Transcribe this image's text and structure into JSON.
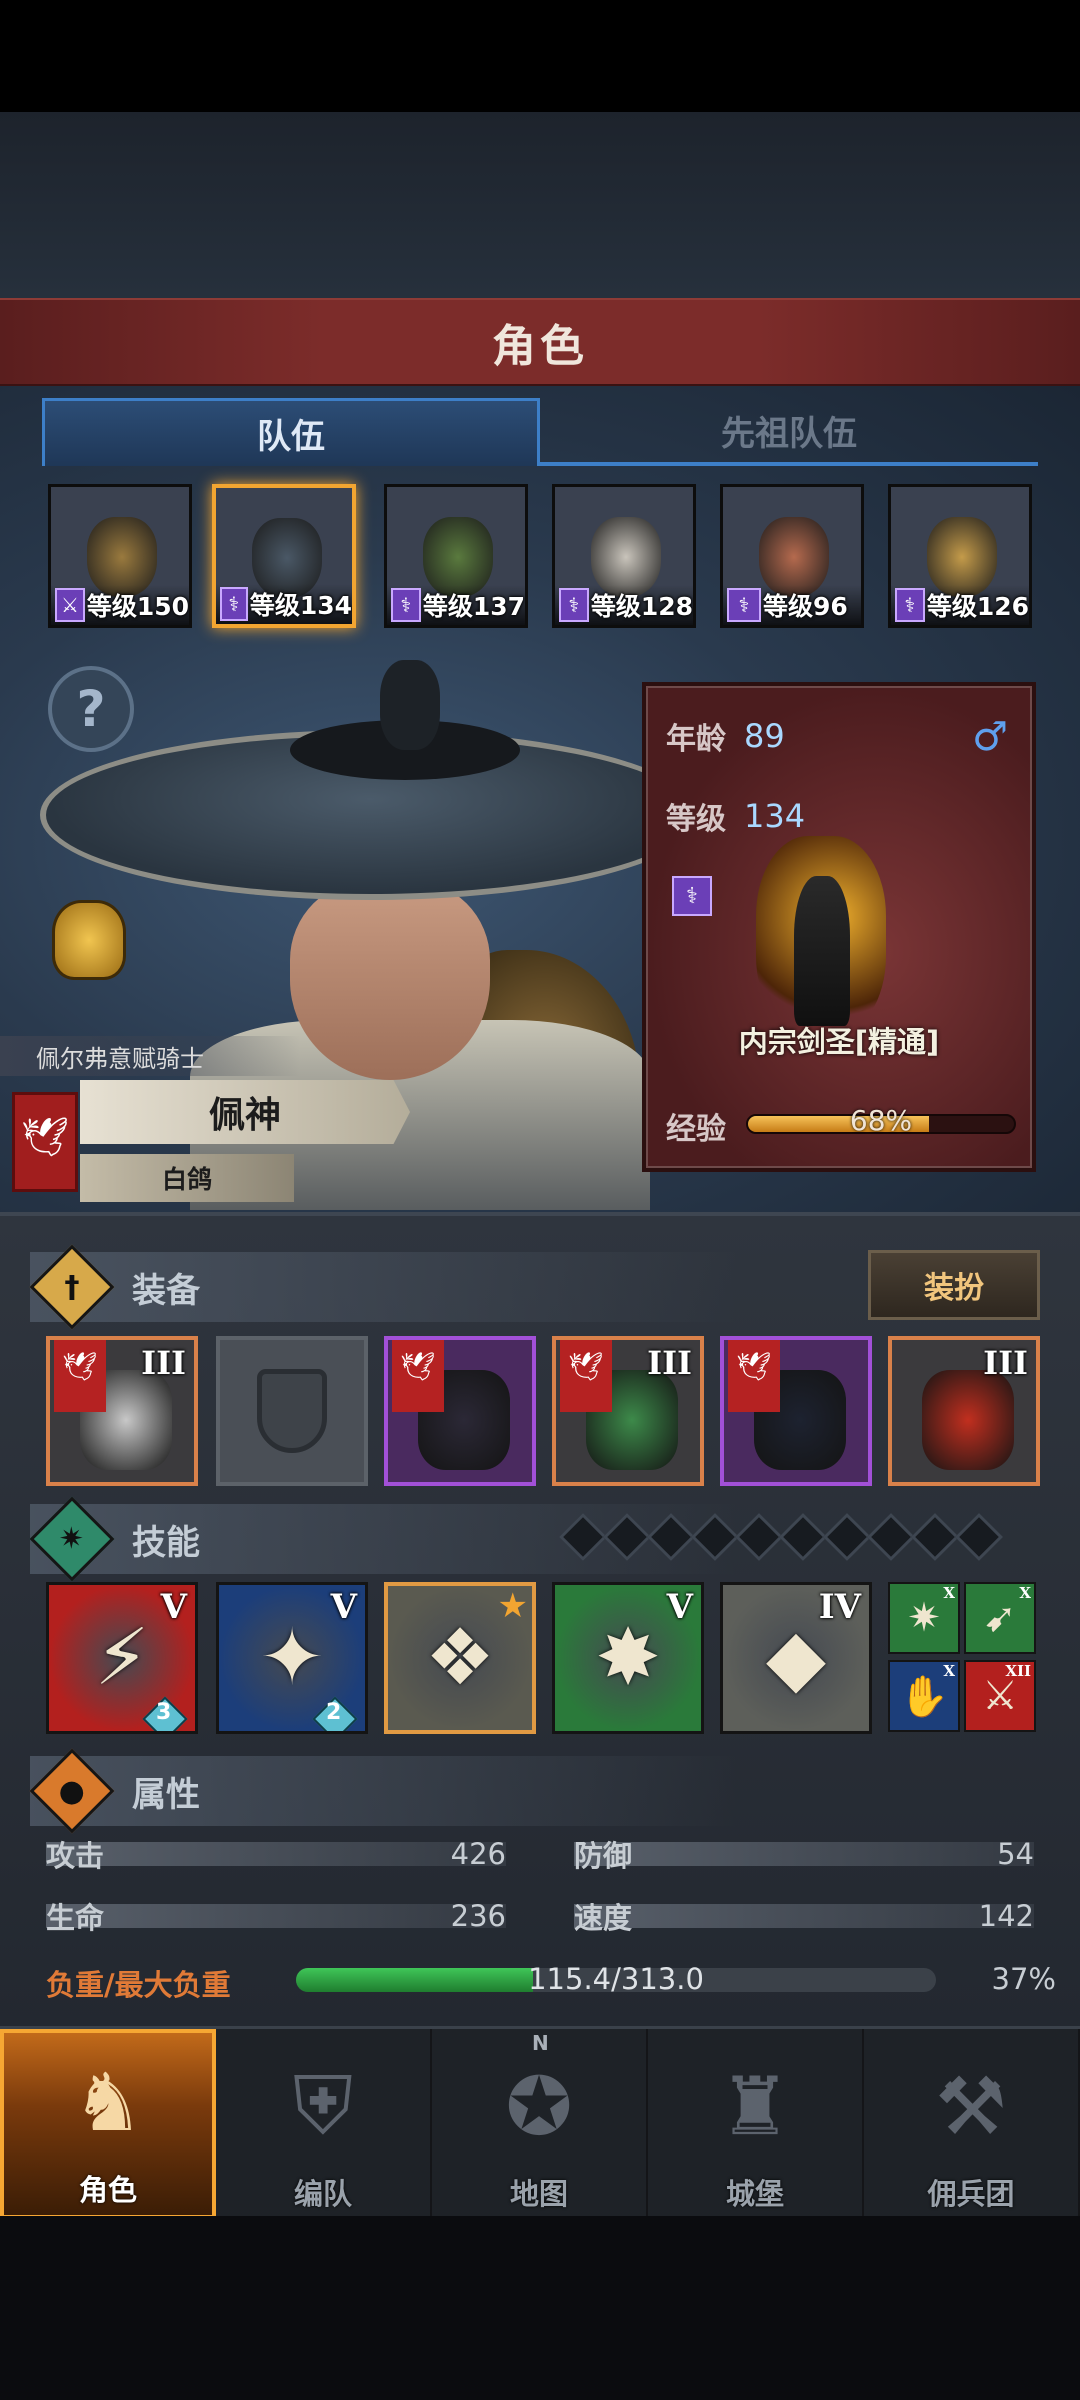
{
  "header": {
    "title": "角色"
  },
  "tabs": [
    {
      "label": "队伍",
      "active": true
    },
    {
      "label": "先祖队伍",
      "active": false
    }
  ],
  "team": [
    {
      "level_text": "等级150",
      "weapon_icon": "sword-icon",
      "color": "#9a7a3e",
      "selected": false
    },
    {
      "level_text": "等级134",
      "weapon_icon": "staff-icon",
      "color": "#4a5866",
      "selected": true
    },
    {
      "level_text": "等级137",
      "weapon_icon": "staff-icon",
      "color": "#5a7a3e",
      "selected": false
    },
    {
      "level_text": "等级128",
      "weapon_icon": "staff-icon",
      "color": "#c9c4bb",
      "selected": false
    },
    {
      "level_text": "等级96",
      "weapon_icon": "staff-icon",
      "color": "#b56a4e",
      "selected": false
    },
    {
      "level_text": "等级126",
      "weapon_icon": "staff-icon",
      "color": "#c49b4a",
      "selected": false
    }
  ],
  "character": {
    "subtitle": "佩尔弗意赋骑士",
    "name": "佩神",
    "banner_name": "白鸽",
    "age_label": "年龄",
    "age": "89",
    "level_label": "等级",
    "level": "134",
    "gender_icon": "male-icon",
    "class_name": "内宗剑圣[精通]",
    "exp_label": "经验",
    "exp_text": "68%",
    "exp_fraction": 0.68
  },
  "equipment": {
    "title": "装备",
    "dress_button": "装扮",
    "slots": [
      {
        "tier": "III",
        "rarity": "orange",
        "has_flag": true
      },
      {
        "tier": "",
        "rarity": "empty",
        "has_flag": false
      },
      {
        "tier": "",
        "rarity": "purple",
        "has_flag": true
      },
      {
        "tier": "III",
        "rarity": "orange",
        "has_flag": true
      },
      {
        "tier": "",
        "rarity": "purple",
        "has_flag": true
      },
      {
        "tier": "III",
        "rarity": "orange",
        "has_flag": false
      }
    ]
  },
  "skills": {
    "title": "技能",
    "pips": 10,
    "main": [
      {
        "tier": "V",
        "gem": "3",
        "bg": "#b3201e"
      },
      {
        "tier": "V",
        "gem": "2",
        "bg": "#1c3e7a"
      },
      {
        "tier": "",
        "gem": "",
        "bg": "#5a5a50",
        "starred": true
      },
      {
        "tier": "V",
        "gem": "",
        "bg": "#2a7a3a"
      },
      {
        "tier": "IV",
        "gem": "",
        "bg": "#5d5f5a"
      }
    ],
    "mini": [
      {
        "tier": "X",
        "bg": "#2a7a3a"
      },
      {
        "tier": "X",
        "bg": "#2a7a3a"
      },
      {
        "tier": "X",
        "bg": "#1c3e7a"
      },
      {
        "tier": "XII",
        "bg": "#b3201e"
      }
    ]
  },
  "attributes": {
    "title": "属性",
    "attack_label": "攻击",
    "attack": "426",
    "defense_label": "防御",
    "defense": "54",
    "hp_label": "生命",
    "hp": "236",
    "speed_label": "速度",
    "speed": "142",
    "load_label": "负重/最大负重",
    "load_text": "115.4/313.0",
    "load_pct": "37%",
    "load_fraction": 0.37
  },
  "nav": [
    {
      "label": "角色",
      "icon": "knight-icon",
      "active": true
    },
    {
      "label": "编队",
      "icon": "formation-icon",
      "active": false
    },
    {
      "label": "地图",
      "icon": "compass-map-icon",
      "active": false
    },
    {
      "label": "城堡",
      "icon": "castle-icon",
      "active": false
    },
    {
      "label": "佣兵团",
      "icon": "mercenary-icon",
      "active": false
    }
  ],
  "compass_mark": "N",
  "colors": {
    "accent": "#f2a531",
    "tab_blue": "#3d7fc8",
    "header_red": "#7c2c2a",
    "load_green": "#3fc658"
  }
}
